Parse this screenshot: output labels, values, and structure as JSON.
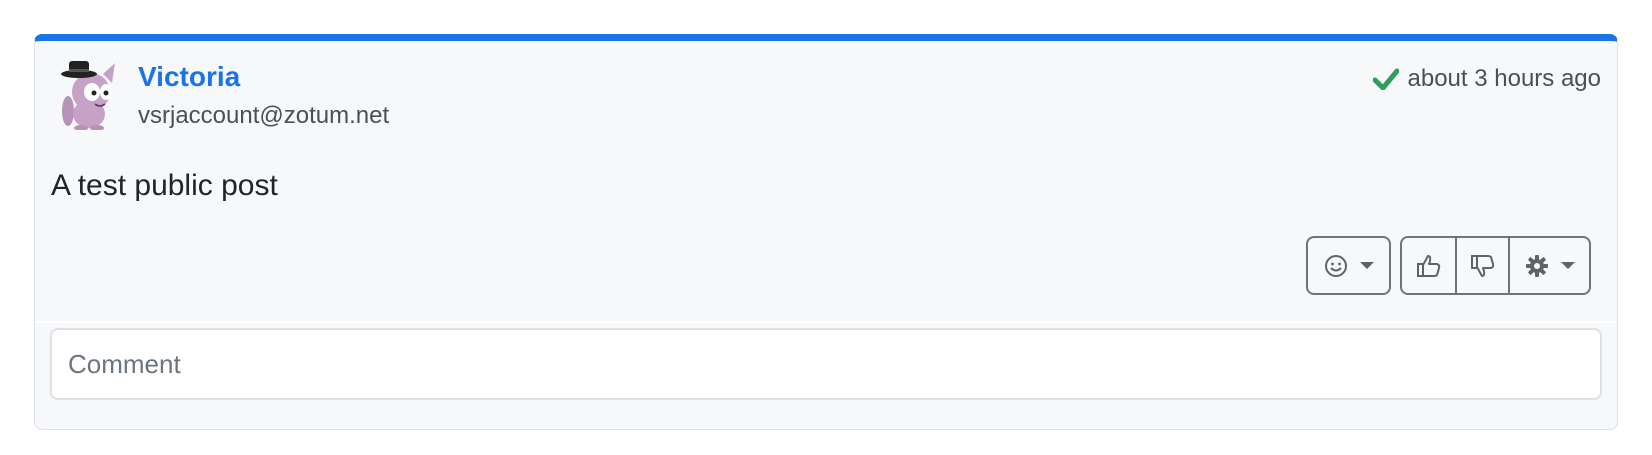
{
  "post": {
    "author_name": "Victoria",
    "author_handle": "vsrjaccount@zotum.net",
    "timestamp": "about 3 hours ago",
    "status_icon": "checkmark-icon",
    "content": "A test public post",
    "avatar_icon": "cat-with-hat-avatar"
  },
  "actions": {
    "emoji_icon": "smiley-icon",
    "like_icon": "thumbs-up-icon",
    "dislike_icon": "thumbs-down-icon",
    "settings_icon": "gear-icon"
  },
  "comment": {
    "placeholder": "Comment"
  },
  "colors": {
    "accent": "#1a73e8",
    "check": "#2e9e5b",
    "card_bg": "#f6f8fa",
    "button_border": "#6c757d"
  }
}
